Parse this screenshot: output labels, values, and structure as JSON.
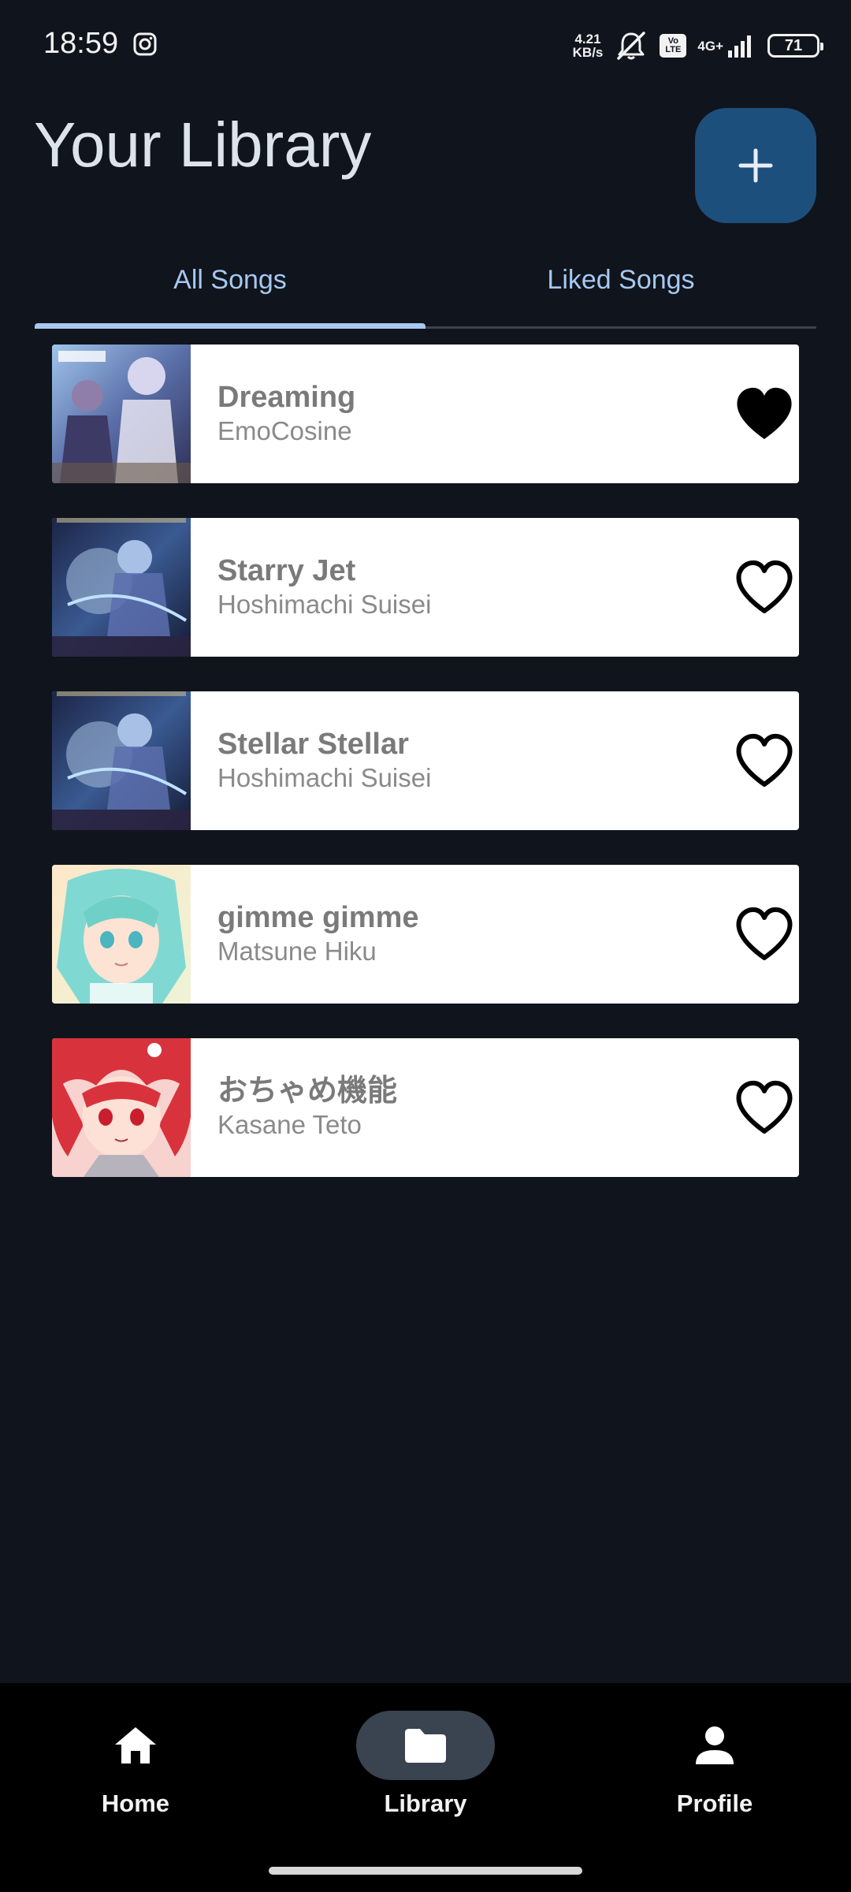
{
  "status_bar": {
    "time": "18:59",
    "net_speed_value": "4.21",
    "net_speed_unit": "KB/s",
    "volte": "Vo LTE",
    "network": "4G+",
    "battery": "71",
    "icons": [
      "instagram-icon",
      "mute-icon",
      "volte-icon",
      "signal-icon",
      "battery-icon"
    ]
  },
  "header": {
    "title": "Your Library",
    "add_icon": "plus-icon"
  },
  "tabs": [
    {
      "label": "All Songs",
      "active": true
    },
    {
      "label": "Liked Songs",
      "active": false
    }
  ],
  "songs": [
    {
      "title": "Dreaming",
      "artist": "EmoCosine",
      "liked": true
    },
    {
      "title": "Starry Jet",
      "artist": "Hoshimachi Suisei",
      "liked": false
    },
    {
      "title": "Stellar Stellar",
      "artist": "Hoshimachi Suisei",
      "liked": false
    },
    {
      "title": "gimme gimme",
      "artist": "Matsune Hiku",
      "liked": false
    },
    {
      "title": "おちゃめ機能",
      "artist": "Kasane Teto",
      "liked": false
    }
  ],
  "bottom_nav": [
    {
      "label": "Home",
      "icon": "home-icon",
      "active": false
    },
    {
      "label": "Library",
      "icon": "folder-icon",
      "active": true
    },
    {
      "label": "Profile",
      "icon": "person-icon",
      "active": false
    }
  ],
  "colors": {
    "background": "#10141c",
    "accent": "#a7c8f0",
    "fab": "#1d4f7c",
    "nav_active_pill": "#3a4350"
  }
}
